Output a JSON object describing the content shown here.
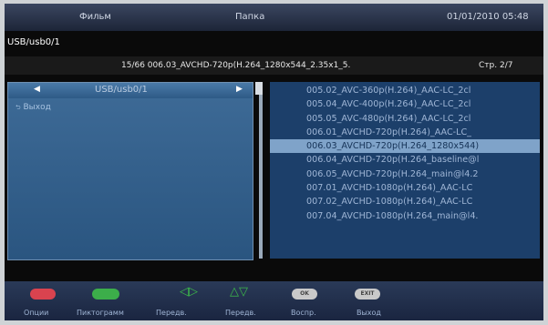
{
  "header": {
    "film": "Фильм",
    "folder": "Папка",
    "datetime": "01/01/2010 05:48"
  },
  "path": "USB/usb0/1",
  "info": {
    "file": "15/66 006.03_AVCHD-720p(H.264_1280x544_2.35x1_5.",
    "page": "Стр. 2/7"
  },
  "left_pane": {
    "header": "USB/usb0/1",
    "items": [
      "Выход"
    ]
  },
  "files": [
    "005.02_AVC-360p(H.264)_AAC-LC_2cl",
    "005.04_AVC-400p(H.264)_AAC-LC_2cl",
    "005.05_AVC-480p(H.264)_AAC-LC_2cl",
    "006.01_AVCHD-720p(H.264)_AAC-LC_",
    "006.03_AVCHD-720p(H.264_1280x544)",
    "006.04_AVCHD-720p(H.264_baseline@l",
    "006.05_AVCHD-720p(H.264_main@l4.2",
    "007.01_AVCHD-1080p(H.264)_AAC-LC",
    "007.02_AVCHD-1080p(H.264)_AAC-LC",
    "007.04_AVCHD-1080p(H.264_main@l4."
  ],
  "selected_index": 4,
  "buttons": {
    "options": "Опции",
    "thumbnails": "Пиктограмм",
    "prev": "Передв.",
    "next": "Передв.",
    "play": "Воспр.",
    "exit": "Выход",
    "ok_key": "OK",
    "exit_key": "EXIT"
  },
  "colors": {
    "red": "#d9434f",
    "green": "#3cae4a",
    "selected": "#7fa3c9"
  }
}
